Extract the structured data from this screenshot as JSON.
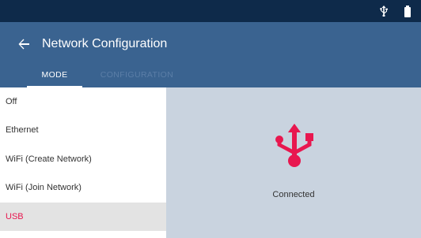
{
  "status_bar": {
    "icons": [
      "usb-icon",
      "battery-icon"
    ]
  },
  "app_bar": {
    "back_icon": "back-arrow-icon",
    "title": "Network Configuration"
  },
  "tabs": [
    {
      "label": "MODE",
      "active": true
    },
    {
      "label": "CONFIGURATION",
      "active": false
    }
  ],
  "mode_list": {
    "items": [
      {
        "label": "Off"
      },
      {
        "label": "Ethernet"
      },
      {
        "label": "WiFi (Create Network)"
      },
      {
        "label": "WiFi (Join Network)"
      },
      {
        "label": "USB"
      }
    ],
    "selected_index": 4
  },
  "detail": {
    "icon": "usb-icon",
    "status": "Connected"
  },
  "colors": {
    "status_bar": "#0e2a4a",
    "app_bar": "#3a6390",
    "accent": "#e8174f",
    "detail_bg": "#c9d3df"
  }
}
